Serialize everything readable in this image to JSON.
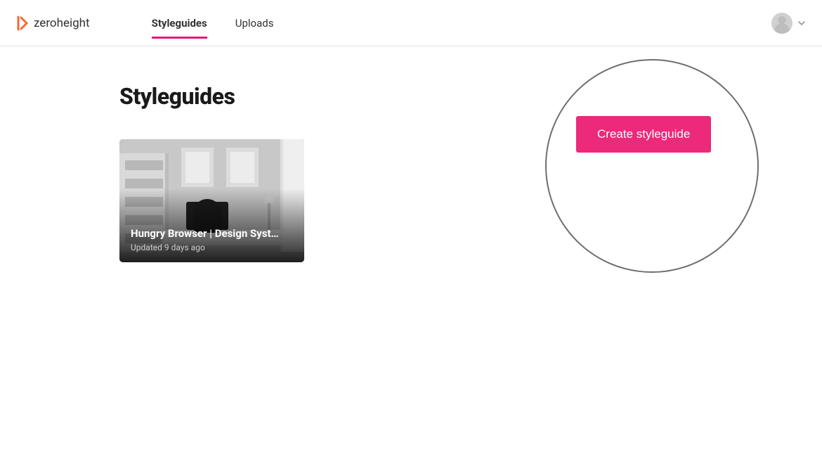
{
  "brand": {
    "name": "zeroheight",
    "accent": "#e9177b",
    "logo_orange": "#f26a3b"
  },
  "nav": {
    "items": [
      {
        "label": "Styleguides",
        "active": true
      },
      {
        "label": "Uploads",
        "active": false
      }
    ]
  },
  "header": {
    "avatar_menu_icon": "chevron-down"
  },
  "page": {
    "title": "Styleguides",
    "create_button_label": "Create styleguide"
  },
  "cards": [
    {
      "title": "Hungry Browser | Design Syst…",
      "subtitle": "Updated 9 days ago"
    }
  ],
  "colors": {
    "button_bg": "#ec297b",
    "button_text": "#ffffff",
    "divider": "#e5e5e5",
    "circle_stroke": "#6e6e6e"
  }
}
